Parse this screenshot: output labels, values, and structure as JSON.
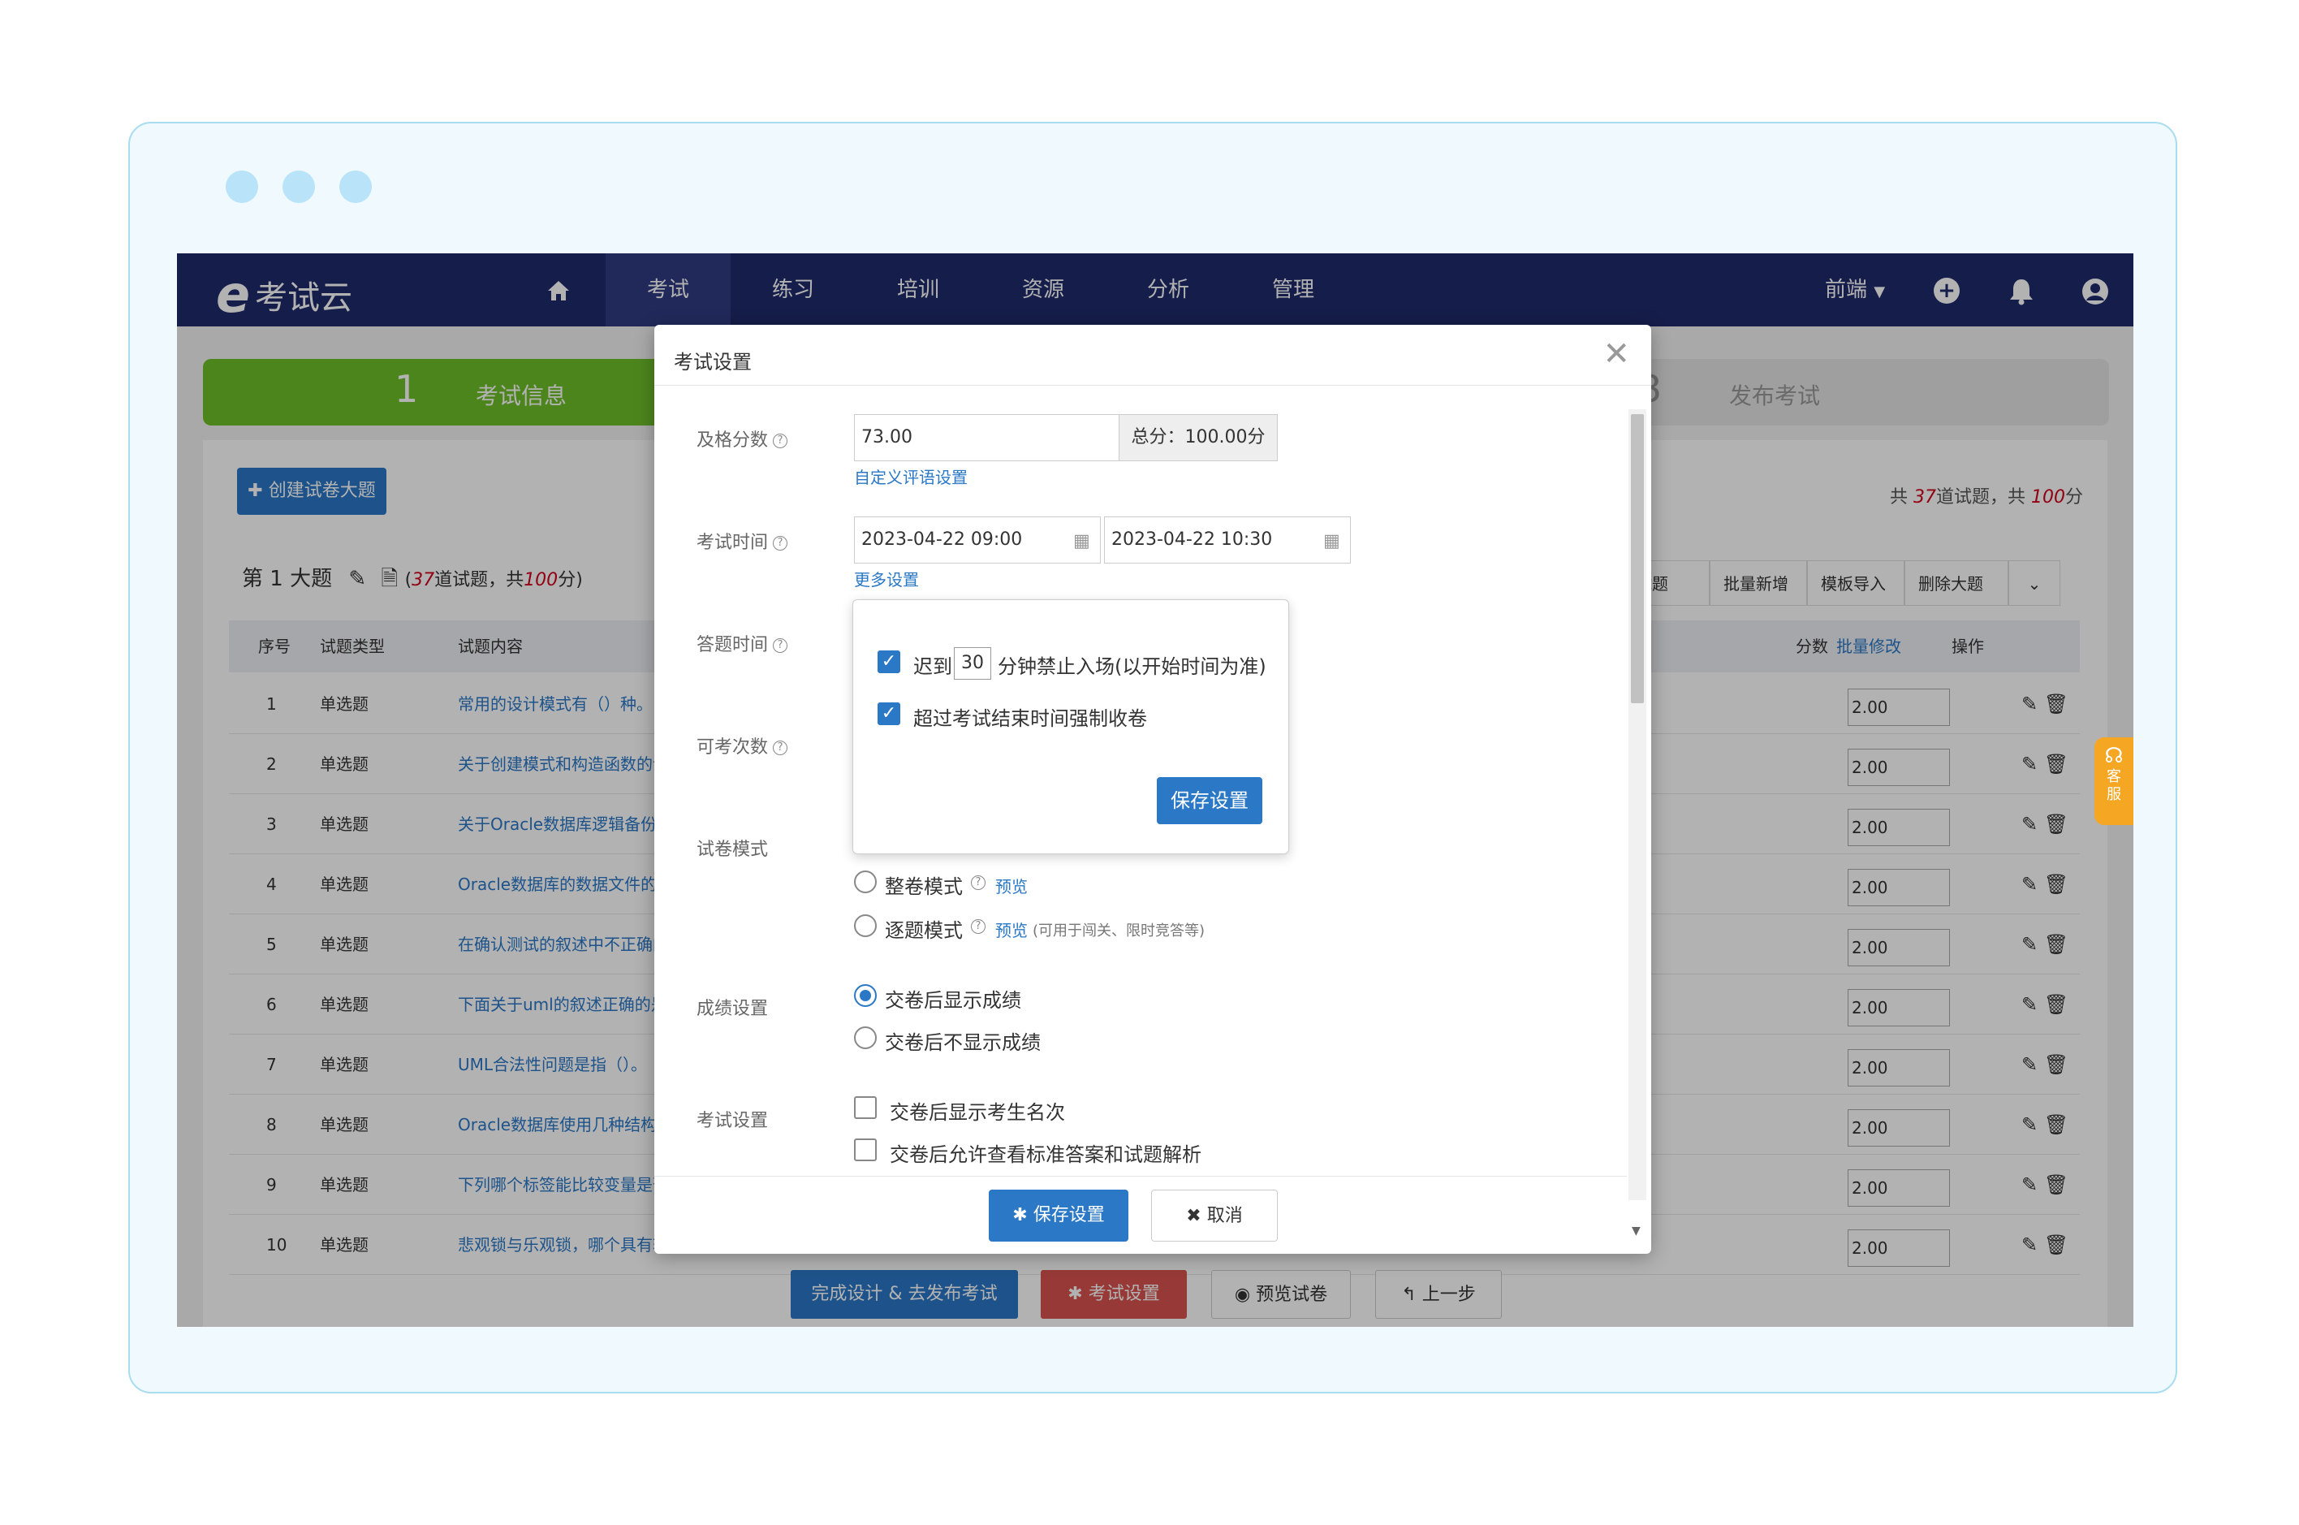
{
  "nav": {
    "logo_mark": "e",
    "logo_text": "考试云",
    "home_icon": "home-icon",
    "items": [
      {
        "label": "考试"
      },
      {
        "label": "练习"
      },
      {
        "label": "培训"
      },
      {
        "label": "资源"
      },
      {
        "label": "分析"
      },
      {
        "label": "管理"
      }
    ],
    "user_menu": "前端",
    "accent": "#1f2a6b"
  },
  "steps": {
    "step1_num": "1",
    "step1_label": "考试信息",
    "step3_num": "3",
    "step3_label": "发布考试"
  },
  "toolbar": {
    "create_btn": "创建试卷大题",
    "summary_prefix": "共",
    "summary_q": "37",
    "summary_mid": "道试题，共",
    "summary_score": "100",
    "summary_suffix": "分",
    "section_title": "第 1 大题",
    "section_q": "37",
    "section_mid": "道试题，共",
    "section_score": "100",
    "btn_add": "增试题",
    "btn_batch": "批量新增",
    "btn_import": "模板导入",
    "btn_del": "删除大题"
  },
  "table": {
    "headers": {
      "no": "序号",
      "type": "试题类型",
      "content": "试题内容",
      "score": "分数",
      "batch_edit": "批量修改",
      "ops": "操作"
    },
    "rows": [
      {
        "no": "1",
        "type": "单选题",
        "content": "常用的设计模式有（）种。",
        "score": "2.00"
      },
      {
        "no": "2",
        "type": "单选题",
        "content": "关于创建模式和构造函数的说",
        "score": "2.00"
      },
      {
        "no": "3",
        "type": "单选题",
        "content": "关于Oracle数据库逻辑备份和",
        "score": "2.00"
      },
      {
        "no": "4",
        "type": "单选题",
        "content": "Oracle数据库的数据文件的特",
        "score": "2.00"
      },
      {
        "no": "5",
        "type": "单选题",
        "content": "在确认测试的叙述中不正确的",
        "score": "2.00"
      },
      {
        "no": "6",
        "type": "单选题",
        "content": "下面关于uml的叙述正确的是",
        "score": "2.00"
      },
      {
        "no": "7",
        "type": "单选题",
        "content": "UML合法性问题是指（）。",
        "score": "2.00"
      },
      {
        "no": "8",
        "type": "单选题",
        "content": "Oracle数据库使用几种结构来",
        "score": "2.00"
      },
      {
        "no": "9",
        "type": "单选题",
        "content": "下列哪个标签能比较变量是否",
        "score": "2.00"
      },
      {
        "no": "10",
        "type": "单选题",
        "content": "悲观锁与乐观锁，哪个具有较",
        "score": "2.00"
      }
    ]
  },
  "bottom": {
    "finish": "完成设计 & 去发布考试",
    "settings": "考试设置",
    "preview": "预览试卷",
    "prev": "上一步"
  },
  "support": {
    "label": "客服"
  },
  "modal": {
    "title": "考试设置",
    "pass_label": "及格分数",
    "pass_value": "73.00",
    "total_score": "总分：100.00分",
    "custom_comment": "自定义评语设置",
    "time_label": "考试时间",
    "start": "2023-04-22 09:00",
    "end": "2023-04-22 10:30",
    "more": "更多设置",
    "answer_time_label": "答题时间",
    "attempts_label": "可考次数",
    "paper_mode_label": "试卷模式",
    "whole_mode": "整卷模式",
    "step_mode": "逐题模式",
    "preview": "预览",
    "step_note": "(可用于闯关、限时竞答等)",
    "score_label": "成绩设置",
    "show_score": "交卷后显示成绩",
    "hide_score": "交卷后不显示成绩",
    "exam_label": "考试设置",
    "show_rank": "交卷后显示考生名次",
    "allow_answer": "交卷后允许查看标准答案和试题解析",
    "save": "保存设置",
    "cancel": "取消"
  },
  "popover": {
    "late_prefix": "迟到",
    "late_minutes": "30",
    "late_suffix": "分钟禁止入场(以开始时间为准)",
    "force_submit": "超过考试结束时间强制收卷",
    "save": "保存设置"
  }
}
